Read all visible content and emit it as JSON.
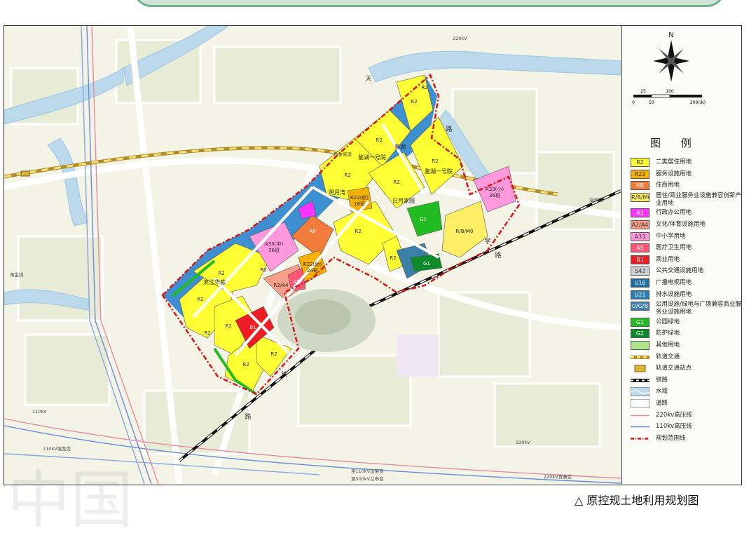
{
  "caption": "原控规土地利用规划图",
  "legend": {
    "title": "图 例",
    "items": [
      {
        "code": "R2",
        "label": "二类居住用地",
        "fill": "#ffff33",
        "text": "#333333"
      },
      {
        "code": "R22",
        "label": "服务设施用地",
        "fill": "#f5b100",
        "text": "#333333"
      },
      {
        "code": "RB",
        "label": "住商用地",
        "fill": "#f07b3a",
        "text": "#ffffff"
      },
      {
        "code": "R/B/M0",
        "label": "居住/商业服务业设施兼容创新产业用地",
        "fill": "#ffee66",
        "text": "#333333"
      },
      {
        "code": "A1",
        "label": "行政办公用地",
        "fill": "#ff33ff",
        "text": "#ffffff"
      },
      {
        "code": "A2/A4",
        "label": "文化/体育设施用地",
        "fill": "#f7a087",
        "text": "#333333"
      },
      {
        "code": "A33",
        "label": "中小学用地",
        "fill": "#ff99dd",
        "text": "#333333"
      },
      {
        "code": "A5",
        "label": "医疗卫生用地",
        "fill": "#ff5577",
        "text": "#ffffff"
      },
      {
        "code": "B1",
        "label": "商业用地",
        "fill": "#ee1c24",
        "text": "#ffffff"
      },
      {
        "code": "S42",
        "label": "公共交通设施用地",
        "fill": "#cfcfcf",
        "text": "#333333"
      },
      {
        "code": "U16",
        "label": "广播电视用地",
        "fill": "#1e6fa8",
        "text": "#ffffff"
      },
      {
        "code": "U21",
        "label": "排水设施用地",
        "fill": "#2a7cb5",
        "text": "#ffffff"
      },
      {
        "code": "U/G/B",
        "label": "公用设施/绿地与广场兼容商业服务业设施用地",
        "fill": "#3b80a8",
        "text": "#ffffff"
      },
      {
        "code": "G1",
        "label": "公园绿地",
        "fill": "#22bb22",
        "text": "#ffffff"
      },
      {
        "code": "G2",
        "label": "防护绿地",
        "fill": "#0f8a2a",
        "text": "#ffffff"
      },
      {
        "code": "",
        "label": "其他用地",
        "fill": "#aee58a",
        "text": "#333333"
      },
      {
        "code": "",
        "label": "轨道交通",
        "symbol": "rail-transit"
      },
      {
        "code": "",
        "label": "轨道交通站点",
        "symbol": "rail-station"
      },
      {
        "code": "",
        "label": "铁路",
        "symbol": "railway"
      },
      {
        "code": "",
        "label": "水域",
        "symbol": "water"
      },
      {
        "code": "",
        "label": "道路",
        "symbol": "road"
      },
      {
        "code": "",
        "label": "220kv高压线",
        "symbol": "line-220"
      },
      {
        "code": "",
        "label": "110kv高压线",
        "symbol": "line-110"
      },
      {
        "code": "",
        "label": "规划范围线",
        "symbol": "boundary"
      }
    ]
  },
  "scale": {
    "ticks": [
      "0",
      "25",
      "50",
      "100",
      "200(米)"
    ]
  },
  "colors": {
    "residential": "#ffff33",
    "service": "#f5b100",
    "mixed": "#f07b3a",
    "admin": "#ff33ff",
    "culture": "#f7a087",
    "school": "#ff99dd",
    "medical": "#ff5577",
    "commercial": "#ee1c24",
    "park": "#22bb22",
    "green": "#0f8a2a",
    "water": "#3d8fd0",
    "boundary": "#dd1111",
    "base": "#fbfaf1"
  },
  "map": {
    "place_labels": {
      "jiangbin": "滨江华庭",
      "mingyue": "明月湾",
      "jianhu1": "鉴湖一号院",
      "jianhu1b": "鉴湖一号院",
      "riyue": "日月家园",
      "jianhu": "鉴湖"
    },
    "parcel_labels": {
      "r2_a": "R2",
      "r2_b": "R2",
      "r2_c": "R2",
      "r2_d": "R2",
      "r2_e": "R2",
      "r2_f": "R2",
      "r2_g": "R2",
      "r2_h": "R2",
      "r2_i": "R2",
      "r2_j": "R2",
      "r2_k": "R2",
      "r2_l": "R2",
      "r2_m": "R2",
      "r2_n": "R2",
      "r2_o": "R2",
      "rb": "RB",
      "a33_main": "A33(中)",
      "a33_main_sub": "36班",
      "a33_small": "A33(小)",
      "a33_small_sub": "36班",
      "r22": "R22(幼)",
      "r22_sub": "24班",
      "r22b": "R22(幼)",
      "r22b_sub": "18班",
      "rbm0": "R/B/M0",
      "b1": "B1",
      "a5": "A5",
      "g1a": "G1",
      "g1b": "G1",
      "r2a4": "R2/A4"
    },
    "road_labels": {
      "n1": "天",
      "n2": "路",
      "n3": "铁",
      "n4": "路",
      "n5": "学",
      "n6": "路"
    },
    "other_labels": {
      "ring": "甬金高速",
      "west": "甬金线",
      "east": "温州路",
      "sta1": "至110kV山荣变",
      "sta2": "至500kV兰亭变",
      "sta3": "220kV青藤变",
      "sta4": "110kV镜龙变",
      "l1": "110kV",
      "l2": "220kV",
      "l3": "220kV"
    },
    "watermarks": [
      "中国"
    ]
  }
}
